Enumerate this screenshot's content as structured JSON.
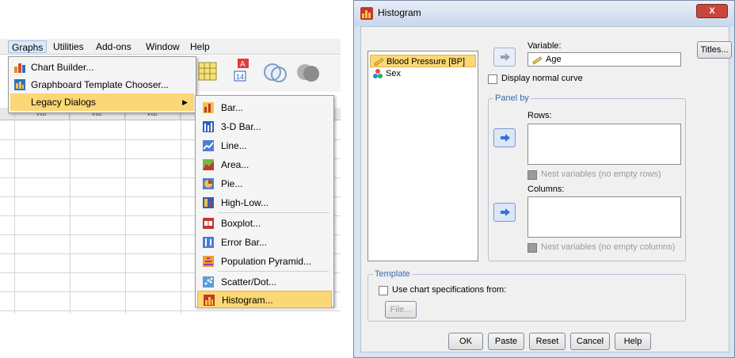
{
  "menubar": {
    "items": [
      {
        "label": "Graphs",
        "active": true
      },
      {
        "label": "Utilities"
      },
      {
        "label": "Add-ons"
      },
      {
        "label": "Window"
      },
      {
        "label": "Help"
      }
    ]
  },
  "graphs_menu": {
    "items": [
      {
        "label": "Chart Builder...",
        "icon": "chart-builder-icon"
      },
      {
        "label": "Graphboard Template Chooser...",
        "icon": "graphboard-icon"
      },
      {
        "label": "Legacy Dialogs",
        "icon": "",
        "submenu": true,
        "highlighted": true
      }
    ]
  },
  "grid": {
    "col_headers": [
      "var",
      "var",
      "var"
    ]
  },
  "legacy_menu": {
    "items": [
      {
        "label": "Bar...",
        "icon": "bar-chart-icon"
      },
      {
        "label": "3-D Bar...",
        "icon": "3d-bar-icon"
      },
      {
        "label": "Line...",
        "icon": "line-chart-icon"
      },
      {
        "label": "Area...",
        "icon": "area-chart-icon"
      },
      {
        "label": "Pie...",
        "icon": "pie-chart-icon"
      },
      {
        "label": "High-Low...",
        "icon": "high-low-icon"
      },
      {
        "label": "Boxplot...",
        "icon": "boxplot-icon"
      },
      {
        "label": "Error Bar...",
        "icon": "error-bar-icon"
      },
      {
        "label": "Population Pyramid...",
        "icon": "pyramid-icon"
      },
      {
        "label": "Scatter/Dot...",
        "icon": "scatter-icon"
      },
      {
        "label": "Histogram...",
        "icon": "histogram-icon",
        "highlighted": true
      }
    ]
  },
  "dialog": {
    "title": "Histogram",
    "close_label": "X",
    "variables": [
      {
        "label": "Blood Pressure [BP]",
        "icon": "scale-variable-icon",
        "selected": true
      },
      {
        "label": "Sex",
        "icon": "nominal-variable-icon"
      }
    ],
    "variable_label": "Variable:",
    "variable_value": "Age",
    "titles_button": "Titles...",
    "display_normal_curve": "Display normal curve",
    "panel_by_label": "Panel by",
    "rows_label": "Rows:",
    "nest_rows": "Nest variables (no empty rows)",
    "columns_label": "Columns:",
    "nest_columns": "Nest variables (no empty columns)",
    "template_label": "Template",
    "use_chart_spec": "Use chart specifications from:",
    "file_button": "File...",
    "buttons": {
      "ok": "OK",
      "paste": "Paste",
      "reset": "Reset",
      "cancel": "Cancel",
      "help": "Help"
    }
  },
  "colors": {
    "highlight": "#fbd875",
    "dialog_frame": "#d9e4f2",
    "close_button": "#c9463d",
    "groupbox_legend": "#3a6aa8"
  }
}
